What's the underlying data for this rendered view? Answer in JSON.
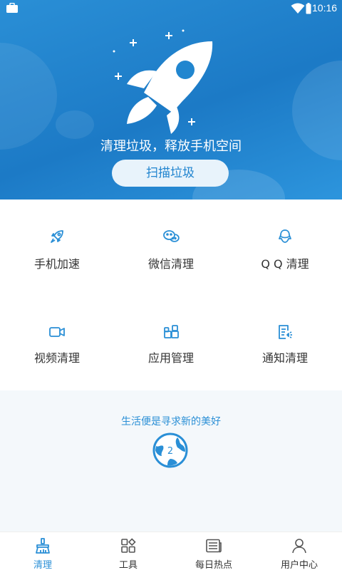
{
  "status_bar": {
    "time": "10:16"
  },
  "hero": {
    "title": "清理垃圾，释放手机空间",
    "scan_button": "扫描垃圾"
  },
  "features": [
    {
      "label": "手机加速",
      "icon": "rocket-icon"
    },
    {
      "label": "微信清理",
      "icon": "wechat-icon"
    },
    {
      "label": "Q Q 清理",
      "icon": "qq-icon"
    },
    {
      "label": "视频清理",
      "icon": "video-icon"
    },
    {
      "label": "应用管理",
      "icon": "apps-icon"
    },
    {
      "label": "通知清理",
      "icon": "notification-icon"
    }
  ],
  "motto": {
    "text": "生活便是寻求新的美好",
    "badge": "2"
  },
  "tabs": [
    {
      "label": "清理",
      "icon": "broom-icon",
      "active": true
    },
    {
      "label": "工具",
      "icon": "tools-icon",
      "active": false
    },
    {
      "label": "每日热点",
      "icon": "news-icon",
      "active": false
    },
    {
      "label": "用户中心",
      "icon": "user-icon",
      "active": false
    }
  ],
  "colors": {
    "primary": "#2a8fd6",
    "hero_dark": "#1c7ac6",
    "text": "#333333",
    "motto_bg": "#f4f8fb"
  }
}
